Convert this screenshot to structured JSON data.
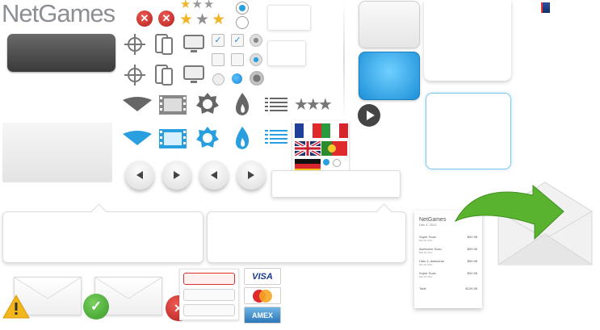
{
  "brand": {
    "logo_text": "NetGames"
  },
  "cards": {
    "visa": "VISA",
    "mastercard": "MasterCard",
    "amex": "AMEX"
  },
  "receipt": {
    "brand": "NetGames",
    "date": "Dec 4, 2012",
    "items": [
      {
        "name": "Super Scan",
        "sub": "$00.00 Offer",
        "price": "$92.98"
      },
      {
        "name": "Awesome Scan",
        "sub": "$00.00 Offer",
        "price": "$59.98"
      },
      {
        "name": "Halo 4, Awesome",
        "sub": "$00.00 Offer",
        "price": "$59.98"
      },
      {
        "name": "Super Scan",
        "sub": "$00.00 Offer",
        "price": "$92.98"
      }
    ],
    "total_label": "Total",
    "total_value": "$126.98"
  },
  "colors": {
    "accent": "#2a9fe0",
    "error": "#d9302c",
    "success": "#4caf37",
    "warning": "#f2b51c",
    "arrow": "#59b32f"
  },
  "icons": {
    "error": "close-icon",
    "warning": "warning-icon",
    "success": "check-icon",
    "play": "play-icon"
  }
}
